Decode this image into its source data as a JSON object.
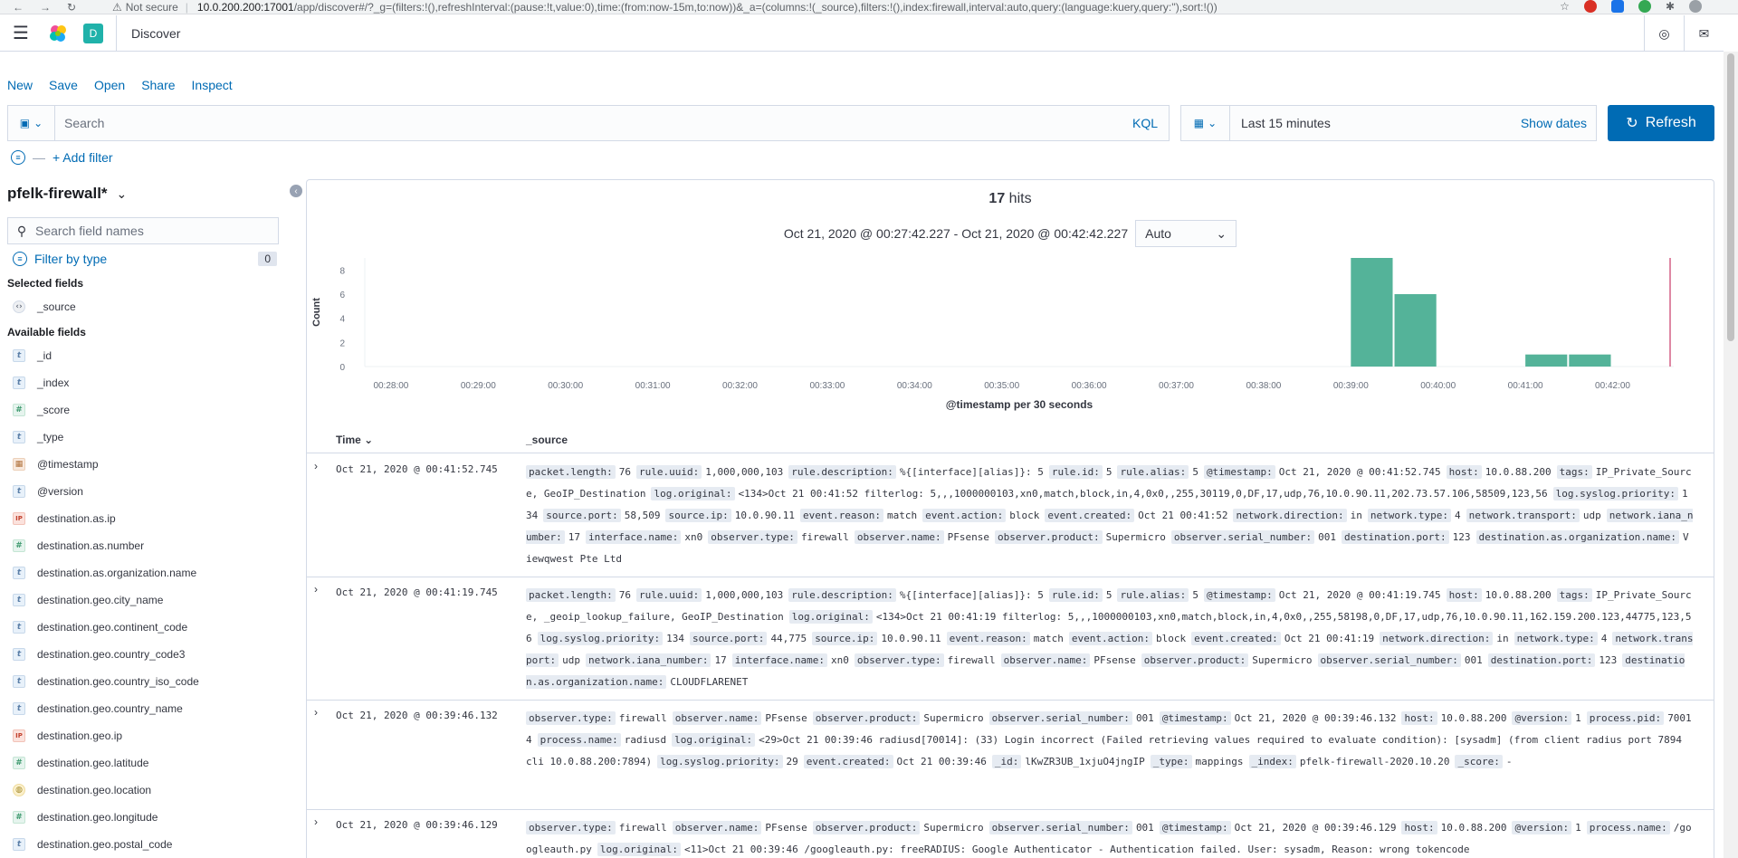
{
  "browser": {
    "security": "Not secure",
    "url_host": "10.0.200.200:17001",
    "url_path": "/app/discover#/?_g=(filters:!(),refreshInterval:(pause:!t,value:0),time:(from:now-15m,to:now))&_a=(columns:!(_source),filters:!(),index:firewall,interval:auto,query:(language:kuery,query:''),sort:!())"
  },
  "header": {
    "space_initial": "D",
    "app_title": "Discover"
  },
  "top_nav": [
    "New",
    "Save",
    "Open",
    "Share",
    "Inspect"
  ],
  "query": {
    "placeholder": "Search",
    "language": "KQL"
  },
  "date": {
    "range": "Last 15 minutes",
    "show_dates": "Show dates",
    "refresh": "Refresh"
  },
  "filters": {
    "add_filter": "+ Add filter"
  },
  "sidebar": {
    "index_pattern": "pfelk-firewall*",
    "search_placeholder": "Search field names",
    "filter_by_type": "Filter by type",
    "filter_count": "0",
    "selected_title": "Selected fields",
    "available_title": "Available fields",
    "selected_fields": [
      {
        "name": "_source",
        "type": "src"
      }
    ],
    "available_fields": [
      {
        "name": "_id",
        "type": "t"
      },
      {
        "name": "_index",
        "type": "t"
      },
      {
        "name": "_score",
        "type": "num"
      },
      {
        "name": "_type",
        "type": "t"
      },
      {
        "name": "@timestamp",
        "type": "date"
      },
      {
        "name": "@version",
        "type": "t"
      },
      {
        "name": "destination.as.ip",
        "type": "ip"
      },
      {
        "name": "destination.as.number",
        "type": "num"
      },
      {
        "name": "destination.as.organization.name",
        "type": "t"
      },
      {
        "name": "destination.geo.city_name",
        "type": "t"
      },
      {
        "name": "destination.geo.continent_code",
        "type": "t"
      },
      {
        "name": "destination.geo.country_code3",
        "type": "t"
      },
      {
        "name": "destination.geo.country_iso_code",
        "type": "t"
      },
      {
        "name": "destination.geo.country_name",
        "type": "t"
      },
      {
        "name": "destination.geo.ip",
        "type": "ip"
      },
      {
        "name": "destination.geo.latitude",
        "type": "num"
      },
      {
        "name": "destination.geo.location",
        "type": "geo"
      },
      {
        "name": "destination.geo.longitude",
        "type": "num"
      },
      {
        "name": "destination.geo.postal_code",
        "type": "t"
      }
    ]
  },
  "results": {
    "hits": "17",
    "hits_label": "hits",
    "range": "Oct 21, 2020 @ 00:27:42.227 - Oct 21, 2020 @ 00:42:42.227",
    "interval": "Auto",
    "col_time": "Time",
    "col_source": "_source"
  },
  "chart_data": {
    "type": "bar",
    "xlabel": "@timestamp per 30 seconds",
    "ylabel": "Count",
    "ylim": [
      0,
      9
    ],
    "yticks": [
      0,
      2,
      4,
      6,
      8
    ],
    "x_ticks": [
      "00:28:00",
      "00:29:00",
      "00:30:00",
      "00:31:00",
      "00:32:00",
      "00:33:00",
      "00:34:00",
      "00:35:00",
      "00:36:00",
      "00:37:00",
      "00:38:00",
      "00:39:00",
      "00:40:00",
      "00:41:00",
      "00:42:00"
    ],
    "x_start": "00:27:42",
    "x_end": "00:42:42",
    "bucket_minutes": 0.5,
    "bars": [
      {
        "x": "00:39:00",
        "value": 9
      },
      {
        "x": "00:39:30",
        "value": 6
      },
      {
        "x": "00:41:00",
        "value": 1
      },
      {
        "x": "00:41:30",
        "value": 1
      }
    ],
    "now_marker": "00:42:42",
    "bar_color": "#54b399",
    "marker_color": "#d36086"
  },
  "docs": [
    {
      "time": "Oct 21, 2020 @ 00:41:52.745",
      "fields": [
        [
          "packet.length:",
          "76"
        ],
        [
          "rule.uuid:",
          "1,000,000,103"
        ],
        [
          "rule.description:",
          "%{[interface][alias]}: 5"
        ],
        [
          "rule.id:",
          "5"
        ],
        [
          "rule.alias:",
          "5"
        ],
        [
          "@timestamp:",
          "Oct 21, 2020 @ 00:41:52.745"
        ],
        [
          "host:",
          "10.0.88.200"
        ],
        [
          "tags:",
          "IP_Private_Source, GeoIP_Destination"
        ],
        [
          "log.original:",
          "<134>Oct 21 00:41:52 filterlog: 5,,,1000000103,xn0,match,block,in,4,0x0,,255,30119,0,DF,17,udp,76,10.0.90.11,202.73.57.106,58509,123,56"
        ],
        [
          "log.syslog.priority:",
          "134"
        ],
        [
          "source.port:",
          "58,509"
        ],
        [
          "source.ip:",
          "10.0.90.11"
        ],
        [
          "event.reason:",
          "match"
        ],
        [
          "event.action:",
          "block"
        ],
        [
          "event.created:",
          "Oct 21 00:41:52"
        ],
        [
          "network.direction:",
          "in"
        ],
        [
          "network.type:",
          "4"
        ],
        [
          "network.transport:",
          "udp"
        ],
        [
          "network.iana_number:",
          "17"
        ],
        [
          "interface.name:",
          "xn0"
        ],
        [
          "observer.type:",
          "firewall"
        ],
        [
          "observer.name:",
          "PFsense"
        ],
        [
          "observer.product:",
          "Supermicro"
        ],
        [
          "observer.serial_number:",
          "001"
        ],
        [
          "destination.port:",
          "123"
        ],
        [
          "destination.as.organization.name:",
          "Viewqwest Pte Ltd"
        ]
      ]
    },
    {
      "time": "Oct 21, 2020 @ 00:41:19.745",
      "fields": [
        [
          "packet.length:",
          "76"
        ],
        [
          "rule.uuid:",
          "1,000,000,103"
        ],
        [
          "rule.description:",
          "%{[interface][alias]}: 5"
        ],
        [
          "rule.id:",
          "5"
        ],
        [
          "rule.alias:",
          "5"
        ],
        [
          "@timestamp:",
          "Oct 21, 2020 @ 00:41:19.745"
        ],
        [
          "host:",
          "10.0.88.200"
        ],
        [
          "tags:",
          "IP_Private_Source, _geoip_lookup_failure, GeoIP_Destination"
        ],
        [
          "log.original:",
          "<134>Oct 21 00:41:19 filterlog: 5,,,1000000103,xn0,match,block,in,4,0x0,,255,58198,0,DF,17,udp,76,10.0.90.11,162.159.200.123,44775,123,56"
        ],
        [
          "log.syslog.priority:",
          "134"
        ],
        [
          "source.port:",
          "44,775"
        ],
        [
          "source.ip:",
          "10.0.90.11"
        ],
        [
          "event.reason:",
          "match"
        ],
        [
          "event.action:",
          "block"
        ],
        [
          "event.created:",
          "Oct 21 00:41:19"
        ],
        [
          "network.direction:",
          "in"
        ],
        [
          "network.type:",
          "4"
        ],
        [
          "network.transport:",
          "udp"
        ],
        [
          "network.iana_number:",
          "17"
        ],
        [
          "interface.name:",
          "xn0"
        ],
        [
          "observer.type:",
          "firewall"
        ],
        [
          "observer.name:",
          "PFsense"
        ],
        [
          "observer.product:",
          "Supermicro"
        ],
        [
          "observer.serial_number:",
          "001"
        ],
        [
          "destination.port:",
          "123"
        ],
        [
          "destination.as.organization.name:",
          "CLOUDFLARENET"
        ]
      ]
    },
    {
      "time": "Oct 21, 2020 @ 00:39:46.132",
      "fields": [
        [
          "observer.type:",
          "firewall"
        ],
        [
          "observer.name:",
          "PFsense"
        ],
        [
          "observer.product:",
          "Supermicro"
        ],
        [
          "observer.serial_number:",
          "001"
        ],
        [
          "@timestamp:",
          "Oct 21, 2020 @ 00:39:46.132"
        ],
        [
          "host:",
          "10.0.88.200"
        ],
        [
          "@version:",
          "1"
        ],
        [
          "process.pid:",
          "70014"
        ],
        [
          "process.name:",
          "radiusd"
        ],
        [
          "log.original:",
          "<29>Oct 21 00:39:46 radiusd[70014]: (33) Login incorrect (Failed retrieving values required to evaluate condition): [sysadm] (from client radius port 7894 cli 10.0.88.200:7894)"
        ],
        [
          "log.syslog.priority:",
          "29"
        ],
        [
          "event.created:",
          "Oct 21 00:39:46"
        ],
        [
          "_id:",
          "lKwZR3UB_1xjuO4jngIP"
        ],
        [
          "_type:",
          "mappings"
        ],
        [
          "_index:",
          "pfelk-firewall-2020.10.20"
        ],
        [
          "_score:",
          "-"
        ]
      ]
    },
    {
      "time": "Oct 21, 2020 @ 00:39:46.129",
      "fields": [
        [
          "observer.type:",
          "firewall"
        ],
        [
          "observer.name:",
          "PFsense"
        ],
        [
          "observer.product:",
          "Supermicro"
        ],
        [
          "observer.serial_number:",
          "001"
        ],
        [
          "@timestamp:",
          "Oct 21, 2020 @ 00:39:46.129"
        ],
        [
          "host:",
          "10.0.88.200"
        ],
        [
          "@version:",
          "1"
        ],
        [
          "process.name:",
          "/googleauth.py"
        ],
        [
          "log.original:",
          "<11>Oct 21 00:39:46 /googleauth.py: freeRADIUS: Google Authenticator - Authentication failed. User: sysadm, Reason: wrong tokencode"
        ]
      ]
    }
  ]
}
